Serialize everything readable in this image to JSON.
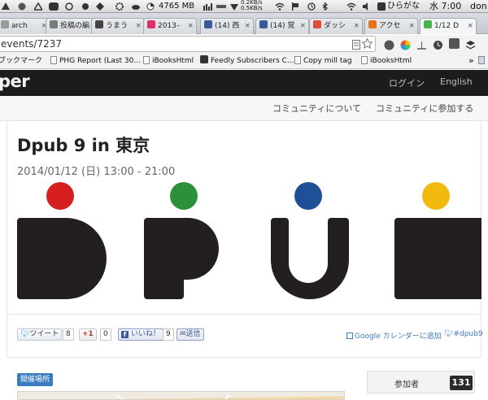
{
  "menubar": {
    "memory": "4765 MB",
    "net_up": "0.2KB/s",
    "net_down": "0.5KB/s",
    "input_method": "ひらがな",
    "clock": "水 7:00",
    "user": "don"
  },
  "tabs": [
    {
      "label": "arch",
      "color": "#999999"
    },
    {
      "label": "投稿の編",
      "color": "#7a7a7a"
    },
    {
      "label": "うまう",
      "color": "#444444"
    },
    {
      "label": "2013–",
      "color": "#e0306b"
    },
    {
      "label": "(14) 西",
      "color": "#3b5998"
    },
    {
      "label": "(14) 覚",
      "color": "#3b5998"
    },
    {
      "label": "ダッシ",
      "color": "#dd4b39"
    },
    {
      "label": "アクセ",
      "color": "#e8711a"
    },
    {
      "label": "1/12 D",
      "color": "#49b549"
    }
  ],
  "address": {
    "url": "events/7237"
  },
  "bookmarks": [
    "ブックマーク",
    "PHG Report (Last 30…",
    "iBooksHtml",
    "Feedly Subscribers C…",
    "Copy mill tag",
    "iBooksHtml"
  ],
  "site": {
    "brand": "per",
    "login": "ログイン",
    "language": "English",
    "nav": [
      "コミュニティについて",
      "コミュニティに参加する"
    ]
  },
  "event": {
    "title": "Dpub 9 in 東京",
    "date": "2014/01/12 (日) 13:00 - 21:00",
    "dot_colors": [
      "#d61f1f",
      "#2c8f3a",
      "#1f4f96",
      "#f2b90f"
    ],
    "letter_color": "#231f20"
  },
  "share": {
    "tweet": "ツイート",
    "tweet_count": "8",
    "gplus": "+1",
    "gplus_count": "0",
    "like": "いいね！",
    "like_count": "9",
    "send": "送信",
    "calendar": "Google カレンダーに追加",
    "hashtag": "#dpub9"
  },
  "venue": {
    "label": "開催場所"
  },
  "attendees": {
    "label": "参加者",
    "count": "131"
  }
}
